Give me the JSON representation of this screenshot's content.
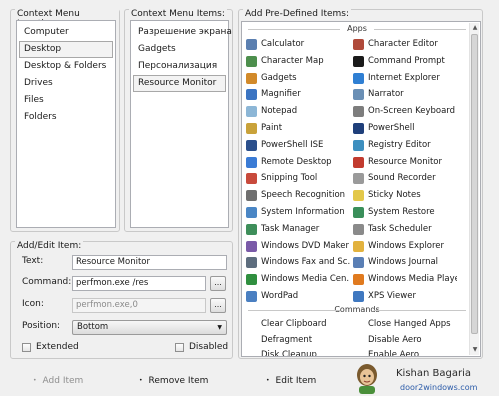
{
  "context_location": {
    "title": "Context Menu Location:",
    "items": [
      "Computer",
      "Desktop",
      "Desktop & Folders",
      "Drives",
      "Files",
      "Folders"
    ],
    "selected": "Desktop"
  },
  "context_items": {
    "title": "Context Menu Items:",
    "items": [
      "Разрешение экрана",
      "Gadgets",
      "Персонализация",
      "Resource Monitor"
    ],
    "selected": "Resource Monitor"
  },
  "predefined": {
    "title": "Add Pre-Defined Items:",
    "apps_header": "Apps",
    "apps_left": [
      {
        "label": "Calculator",
        "icon": "calculator-icon",
        "color": "#5b7fb0"
      },
      {
        "label": "Character Map",
        "icon": "character-map-icon",
        "color": "#4d8f4d"
      },
      {
        "label": "Gadgets",
        "icon": "gadgets-icon",
        "color": "#d28a2a"
      },
      {
        "label": "Magnifier",
        "icon": "magnifier-icon",
        "color": "#3b74c2"
      },
      {
        "label": "Notepad",
        "icon": "notepad-icon",
        "color": "#8cb6d6"
      },
      {
        "label": "Paint",
        "icon": "paint-icon",
        "color": "#c9a23a"
      },
      {
        "label": "PowerShell ISE",
        "icon": "powershell-ise-icon",
        "color": "#2b4f8c"
      },
      {
        "label": "Remote Desktop",
        "icon": "remote-desktop-icon",
        "color": "#3a7bd5"
      },
      {
        "label": "Snipping Tool",
        "icon": "snipping-tool-icon",
        "color": "#c84a3c"
      },
      {
        "label": "Speech Recognition",
        "icon": "speech-recognition-icon",
        "color": "#6f6f6f"
      },
      {
        "label": "System Information",
        "icon": "system-information-icon",
        "color": "#4a86c5"
      },
      {
        "label": "Task Manager",
        "icon": "task-manager-icon",
        "color": "#3e8e5a"
      },
      {
        "label": "Windows DVD Maker",
        "icon": "dvd-maker-icon",
        "color": "#7a5aa8"
      },
      {
        "label": "Windows Fax and Sc...",
        "icon": "fax-scan-icon",
        "color": "#5d6d7e"
      },
      {
        "label": "Windows Media Cen...",
        "icon": "media-center-icon",
        "color": "#2f8f3f"
      },
      {
        "label": "WordPad",
        "icon": "wordpad-icon",
        "color": "#4a7fc1"
      }
    ],
    "apps_right": [
      {
        "label": "Character Editor",
        "icon": "character-editor-icon",
        "color": "#b04a3a"
      },
      {
        "label": "Command Prompt",
        "icon": "command-prompt-icon",
        "color": "#1a1a1a"
      },
      {
        "label": "Internet Explorer",
        "icon": "internet-explorer-icon",
        "color": "#2f7fd3"
      },
      {
        "label": "Narrator",
        "icon": "narrator-icon",
        "color": "#6a8fb5"
      },
      {
        "label": "On-Screen Keyboard",
        "icon": "keyboard-icon",
        "color": "#7d7d7d"
      },
      {
        "label": "PowerShell",
        "icon": "powershell-icon",
        "color": "#1f3f7a"
      },
      {
        "label": "Registry Editor",
        "icon": "registry-editor-icon",
        "color": "#3d8fbf"
      },
      {
        "label": "Resource Monitor",
        "icon": "resource-monitor-icon",
        "color": "#c23b2f"
      },
      {
        "label": "Sound Recorder",
        "icon": "sound-recorder-icon",
        "color": "#9a9a9a"
      },
      {
        "label": "Sticky Notes",
        "icon": "sticky-notes-icon",
        "color": "#e3c84a"
      },
      {
        "label": "System Restore",
        "icon": "system-restore-icon",
        "color": "#3a8f5a"
      },
      {
        "label": "Task Scheduler",
        "icon": "task-scheduler-icon",
        "color": "#8a8a8a"
      },
      {
        "label": "Windows Explorer",
        "icon": "windows-explorer-icon",
        "color": "#e2b23e"
      },
      {
        "label": "Windows Journal",
        "icon": "windows-journal-icon",
        "color": "#5a7fb5"
      },
      {
        "label": "Windows Media Player",
        "icon": "media-player-icon",
        "color": "#e07a1f"
      },
      {
        "label": "XPS Viewer",
        "icon": "xps-viewer-icon",
        "color": "#3f78c0"
      }
    ],
    "commands_header": "Commands",
    "commands_left": [
      "Clear Clipboard",
      "Defragment",
      "Disk Cleanup"
    ],
    "commands_right": [
      "Close Hanged Apps",
      "Disable Aero",
      "Enable Aero"
    ]
  },
  "edit": {
    "title": "Add/Edit Item:",
    "text_label": "Text:",
    "text_value": "Resource Monitor",
    "command_label": "Command:",
    "command_value": "perfmon.exe /res",
    "icon_label": "Icon:",
    "icon_value": "perfmon.exe,0",
    "position_label": "Position:",
    "position_value": "Bottom",
    "browse_label": "...",
    "extended_label": "Extended",
    "disabled_label": "Disabled"
  },
  "actions": {
    "add": "Add Item",
    "remove": "Remove Item",
    "edit": "Edit Item"
  },
  "watermark": {
    "name": "Kishan Bagaria",
    "site": "door2windows.com"
  }
}
